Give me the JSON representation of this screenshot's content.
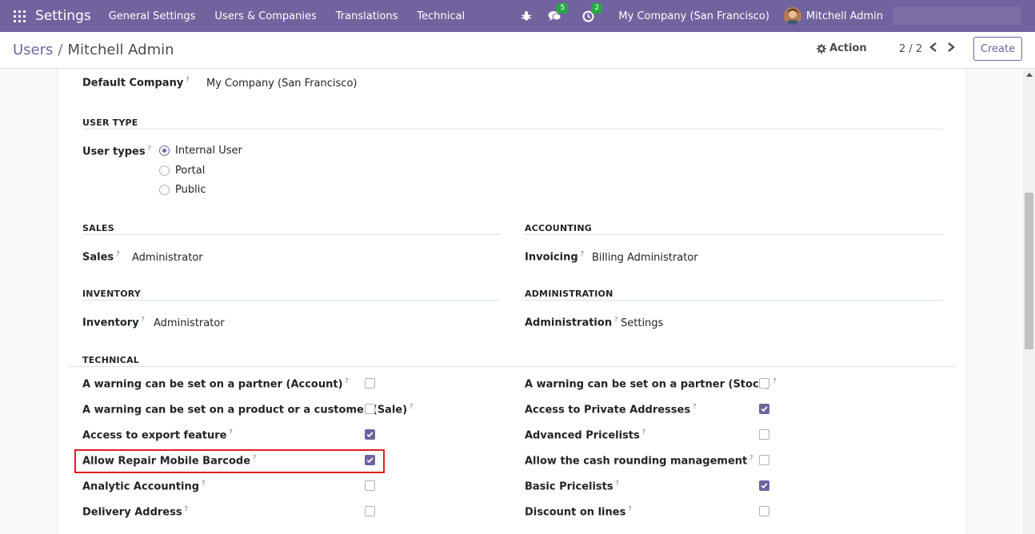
{
  "navbar": {
    "brand": "Settings",
    "menu": [
      "General Settings",
      "Users & Companies",
      "Translations",
      "Technical"
    ],
    "chat_badge": "5",
    "activity_badge": "2",
    "company": "My Company (San Francisco)",
    "user": "Mitchell Admin",
    "colors": {
      "navbar": "#71639e",
      "badge": "#28a745"
    }
  },
  "control_panel": {
    "breadcrumb_parent": "Users",
    "breadcrumb_current": "Mitchell Admin",
    "action_label": "Action",
    "pager": "2 / 2",
    "create_label": "Create"
  },
  "form": {
    "default_company_label": "Default Company",
    "default_company_value": "My Company (San Francisco)",
    "user_type_section": "USER TYPE",
    "user_types_label": "User types",
    "user_types_options": [
      "Internal User",
      "Portal",
      "Public"
    ],
    "user_types_selected": "Internal User",
    "sales_section": "SALES",
    "sales_label": "Sales",
    "sales_value": "Administrator",
    "accounting_section": "ACCOUNTING",
    "invoicing_label": "Invoicing",
    "invoicing_value": "Billing Administrator",
    "inventory_section": "INVENTORY",
    "inventory_label": "Inventory",
    "inventory_value": "Administrator",
    "administration_section": "ADMINISTRATION",
    "administration_label": "Administration",
    "administration_value": "Settings",
    "technical_section": "TECHNICAL",
    "help_mark": "?",
    "technical_left": [
      {
        "label": "A warning can be set on a partner (Account)",
        "checked": false
      },
      {
        "label": "A warning can be set on a product or a customer (Sale)",
        "checked": false
      },
      {
        "label": "Access to export feature",
        "checked": true
      },
      {
        "label": "Allow Repair Mobile Barcode",
        "checked": true
      },
      {
        "label": "Analytic Accounting",
        "checked": false
      },
      {
        "label": "Delivery Address",
        "checked": false
      }
    ],
    "technical_right": [
      {
        "label": "A warning can be set on a partner (Stock)",
        "checked": false
      },
      {
        "label": "Access to Private Addresses",
        "checked": true
      },
      {
        "label": "Advanced Pricelists",
        "checked": false
      },
      {
        "label": "Allow the cash rounding management",
        "checked": false
      },
      {
        "label": "Basic Pricelists",
        "checked": true
      },
      {
        "label": "Discount on lines",
        "checked": false
      }
    ]
  }
}
